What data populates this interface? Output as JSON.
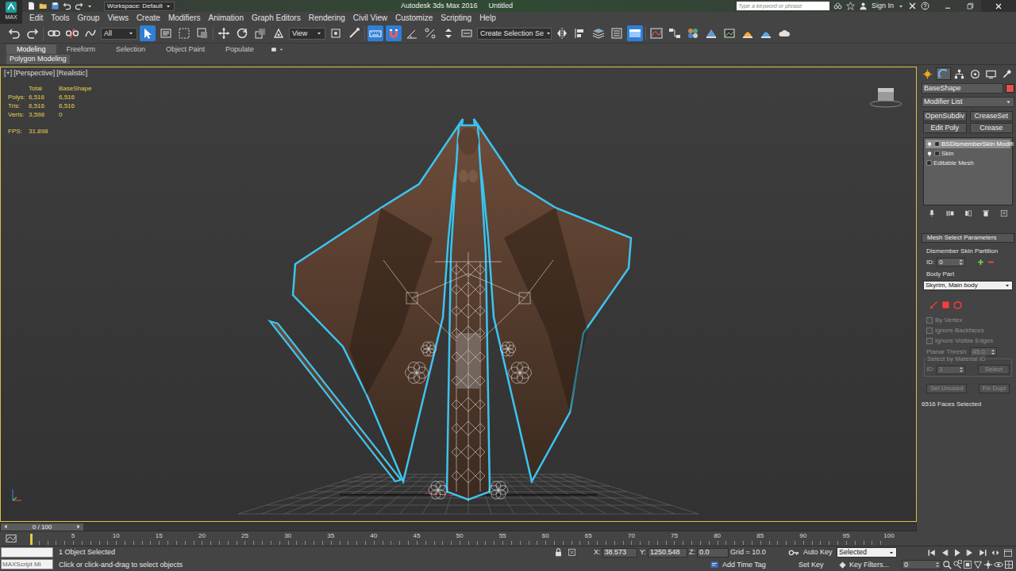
{
  "window": {
    "app_button": "MAX",
    "workspace": "Workspace: Default",
    "title": "Autodesk 3ds Max 2016",
    "document": "Untitled",
    "search_placeholder": "Type a keyword or phrase",
    "sign_in": "Sign In"
  },
  "menu": [
    "Edit",
    "Tools",
    "Group",
    "Views",
    "Create",
    "Modifiers",
    "Animation",
    "Graph Editors",
    "Rendering",
    "Civil View",
    "Customize",
    "Scripting",
    "Help"
  ],
  "toolbar": {
    "filter": "All",
    "reference_coord": "View",
    "selection_set": "Create Selection Se",
    "select_active": true,
    "keyboard_override_active": true,
    "snaps_active": true,
    "ribbon_active": true
  },
  "ribbon": {
    "tabs": [
      {
        "label": "Modeling",
        "selected": true
      },
      {
        "label": "Freeform",
        "selected": false
      },
      {
        "label": "Selection",
        "selected": false
      },
      {
        "label": "Object Paint",
        "selected": false
      },
      {
        "label": "Populate",
        "selected": false
      }
    ],
    "panel": "Polygon Modeling"
  },
  "viewport": {
    "active": true,
    "labels": [
      "[+]",
      "[Perspective]",
      "[Realistic]"
    ],
    "stats": {
      "headers": [
        "Total",
        "BaseShape"
      ],
      "rows": [
        {
          "label": "Polys:",
          "total": "6,516",
          "object": "6,516"
        },
        {
          "label": "Tris:",
          "total": "6,516",
          "object": "6,516"
        },
        {
          "label": "Verts:",
          "total": "3,598",
          "object": "0"
        }
      ],
      "fps_label": "FPS:",
      "fps": "31.898"
    }
  },
  "command_panel": {
    "tabs": [
      {
        "selected": false
      },
      {
        "selected": true
      },
      {
        "selected": false
      },
      {
        "selected": false
      },
      {
        "selected": false
      },
      {
        "selected": false
      }
    ],
    "object_name": "BaseShape",
    "modifier_list": "Modifier List",
    "buttons": [
      "OpenSubdiv",
      "CreaseSet",
      "Edit Poly",
      "Crease"
    ],
    "stack": [
      {
        "label": "BSDismemberSkin Modifi",
        "kind": "modifier",
        "selected": true
      },
      {
        "label": "Skin",
        "kind": "modifier",
        "selected": false
      },
      {
        "label": "Editable Mesh",
        "kind": "base",
        "selected": false
      }
    ],
    "rollout": {
      "title": "Mesh Select Parameters",
      "partition_label": "Dismember Skin Partition",
      "id_label": "ID:",
      "id_value": "0",
      "body_part_label": "Body Part",
      "body_part": "Skyrim, Main body",
      "checkboxes": [
        {
          "label": "By Vertex",
          "checked": false,
          "disabled": true
        },
        {
          "label": "Ignore Backfaces",
          "checked": false,
          "disabled": true
        },
        {
          "label": "Ignore Visible Edges",
          "checked": false,
          "disabled": true
        }
      ],
      "planar_label": "Planar Thresh:",
      "planar_value": "45.0",
      "planar_disabled": true,
      "material": {
        "label": "Select by Material ID",
        "id_label": "ID:",
        "id_value": "1",
        "button": "Select",
        "disabled": true
      },
      "buttons": [
        {
          "label": "Sel Unused",
          "disabled": true
        },
        {
          "label": "Fix Dupl",
          "disabled": true
        }
      ],
      "status": "6516 Faces Selected"
    }
  },
  "timeline": {
    "frame": "0 / 100",
    "level": 0,
    "ticks": [
      "5",
      "10",
      "15",
      "20",
      "25",
      "30",
      "35",
      "40",
      "45",
      "50",
      "55",
      "60",
      "65",
      "70",
      "75",
      "80",
      "85",
      "90",
      "95",
      "100"
    ]
  },
  "status_bar": {
    "maxscript": "MAXScript Mi",
    "selection": "1 Object Selected",
    "prompt": "Click or click-and-drag to select objects",
    "x_label": "X:",
    "x": "38.573",
    "y_label": "Y:",
    "y": "1250.548",
    "z_label": "Z:",
    "z": "0.0",
    "grid": "Grid = 10.0",
    "add_time_tag": "Add Time Tag",
    "auto_key": "Auto Key",
    "key_mode": "Selected",
    "set_key": "Set Key",
    "key_filters": "Key Filters...",
    "frame": "0"
  }
}
